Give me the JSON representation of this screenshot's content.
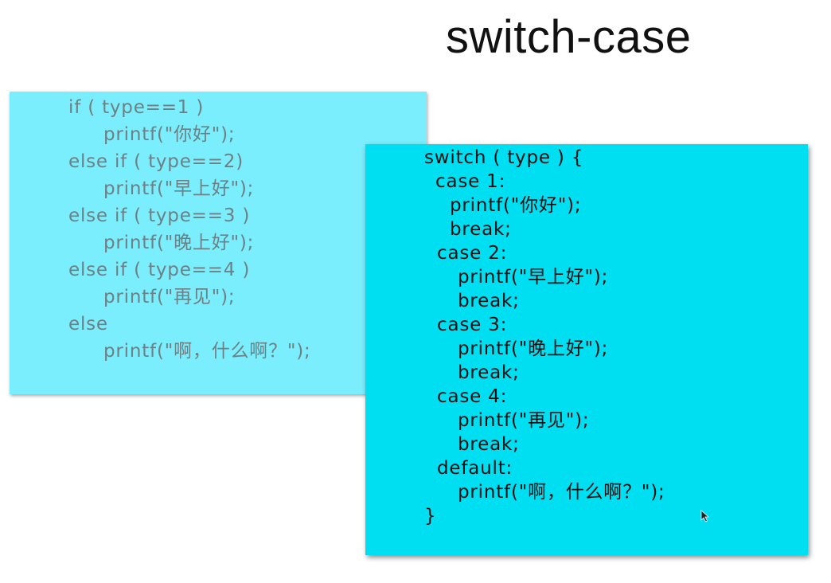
{
  "slide": {
    "title": "switch-case"
  },
  "if_panel": {
    "lines": [
      "if ( type==1 )",
      "printf(\"你好\");",
      "else if ( type==2)",
      "printf(\"早上好\");",
      "else if ( type==3 )",
      "printf(\"晚上好\");",
      "else if ( type==4 )",
      "printf(\"再见\");",
      "else",
      "printf(\"啊，什么啊？\");"
    ]
  },
  "switch_panel": {
    "lines": [
      "switch ( type ) {",
      "case 1:",
      "printf(\"你好\");",
      "break;",
      "case 2:",
      "printf(\"早上好\");",
      "break;",
      "case 3:",
      "printf(\"晚上好\");",
      "break;",
      "case 4:",
      "printf(\"再见\");",
      "break;",
      "default:",
      "printf(\"啊，什么啊？\");",
      "}"
    ]
  },
  "colors": {
    "if_panel_bg": "#7aeefc",
    "switch_panel_bg": "#00def2",
    "if_text": "#6f7f84",
    "switch_text": "#101010"
  },
  "icons": [
    "mouse-cursor-icon"
  ]
}
